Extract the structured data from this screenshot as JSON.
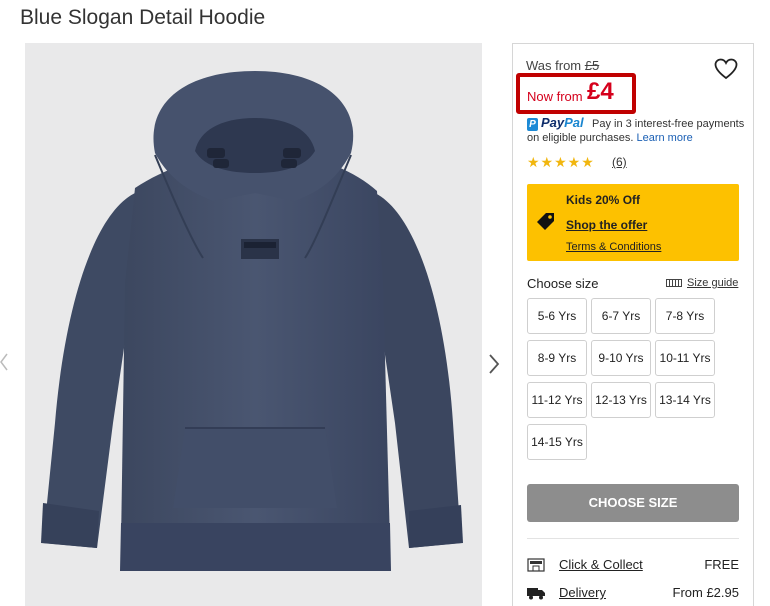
{
  "product": {
    "title": "Blue Slogan Detail Hoodie",
    "was_label": "Was from ",
    "was_price": "£5",
    "now_label": "Now from ",
    "now_price": "£4",
    "rating": 5,
    "stars": "★★★★★",
    "review_count": "(6)"
  },
  "paypal": {
    "logo_pay": "Pay",
    "logo_pal": "Pal",
    "text": "Pay in 3 interest-free payments on eligible purchases. ",
    "learn_more": "Learn more"
  },
  "offer": {
    "title": "Kids 20% Off",
    "link": "Shop the offer",
    "terms": "Terms & Conditions"
  },
  "sizes": {
    "label": "Choose size",
    "guide": "Size guide",
    "options": [
      "5-6 Yrs",
      "6-7 Yrs",
      "7-8 Yrs",
      "8-9 Yrs",
      "9-10 Yrs",
      "10-11 Yrs",
      "11-12 Yrs",
      "12-13 Yrs",
      "13-14 Yrs",
      "14-15 Yrs"
    ]
  },
  "cta": {
    "choose_size": "CHOOSE SIZE"
  },
  "delivery": [
    {
      "label": "Click & Collect",
      "price": "FREE",
      "icon": "store-icon"
    },
    {
      "label": "Delivery",
      "price": "From £2.95",
      "icon": "truck-icon"
    }
  ],
  "colors": {
    "accent_red": "#d5001c",
    "offer_yellow": "#fdc100",
    "hoodie_navy": "#414d66",
    "button_grey": "#8d8d8d"
  }
}
